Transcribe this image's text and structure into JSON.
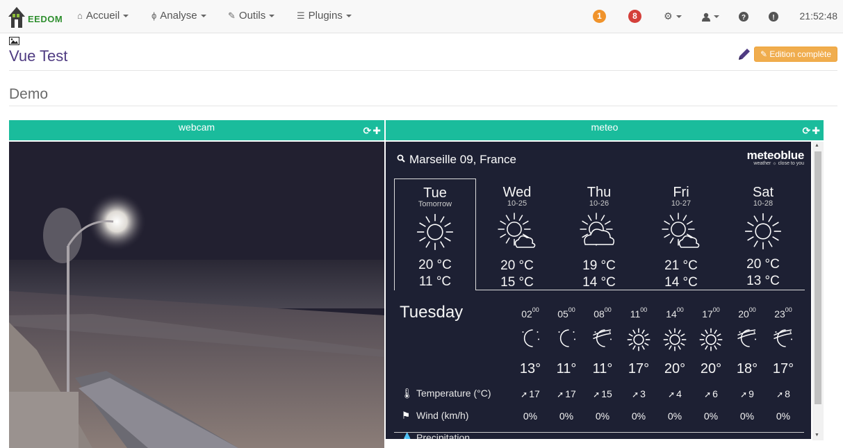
{
  "navbar": {
    "logo_text": "EEDOM",
    "menu": [
      {
        "label": "Accueil",
        "icon": "home-icon"
      },
      {
        "label": "Analyse",
        "icon": "stethoscope-icon"
      },
      {
        "label": "Outils",
        "icon": "wrench-icon"
      },
      {
        "label": "Plugins",
        "icon": "list-icon"
      }
    ],
    "badges": [
      {
        "value": "1",
        "color": "#f0932b"
      },
      {
        "value": "8",
        "color": "#d43f3a"
      }
    ],
    "clock": "21:52:48"
  },
  "view": {
    "title": "Vue Test",
    "edit_button": "Edition complète",
    "section_title": "Demo"
  },
  "widgets": {
    "webcam": {
      "title": "webcam"
    },
    "meteo": {
      "title": "meteo"
    }
  },
  "weather": {
    "location": "Marseille 09, France",
    "brand": "meteoblue",
    "brand_tag": "weather ☼ close to you",
    "days": [
      {
        "name": "Tue",
        "date": "Tomorrow",
        "icon": "sun",
        "max": "20 °C",
        "min": "11 °C"
      },
      {
        "name": "Wed",
        "date": "10-25",
        "icon": "sun-cloud",
        "max": "20 °C",
        "min": "15 °C"
      },
      {
        "name": "Thu",
        "date": "10-26",
        "icon": "cloud-sun",
        "max": "19 °C",
        "min": "14 °C"
      },
      {
        "name": "Fri",
        "date": "10-27",
        "icon": "sun-cloud",
        "max": "21 °C",
        "min": "14 °C"
      },
      {
        "name": "Sat",
        "date": "10-28",
        "icon": "sun",
        "max": "20 °C",
        "min": "13 °C"
      }
    ],
    "detail_day": "Tuesday",
    "labels": {
      "temperature": "Temperature (°C)",
      "wind": "Wind (km/h)",
      "precipitation": "Precipitation"
    },
    "hours": [
      {
        "h": "02",
        "m": "00",
        "icon": "moon",
        "temp": "13°",
        "wind": "17",
        "prec": "0%"
      },
      {
        "h": "05",
        "m": "00",
        "icon": "moon",
        "temp": "11°",
        "wind": "17",
        "prec": "0%"
      },
      {
        "h": "08",
        "m": "00",
        "icon": "moon-haze",
        "temp": "11°",
        "wind": "15",
        "prec": "0%"
      },
      {
        "h": "11",
        "m": "00",
        "icon": "sun",
        "temp": "17°",
        "wind": "3",
        "prec": "0%"
      },
      {
        "h": "14",
        "m": "00",
        "icon": "sun",
        "temp": "20°",
        "wind": "4",
        "prec": "0%"
      },
      {
        "h": "17",
        "m": "00",
        "icon": "sun",
        "temp": "20°",
        "wind": "6",
        "prec": "0%"
      },
      {
        "h": "20",
        "m": "00",
        "icon": "moon-haze",
        "temp": "18°",
        "wind": "9",
        "prec": "0%"
      },
      {
        "h": "23",
        "m": "00",
        "icon": "moon-haze",
        "temp": "17°",
        "wind": "8",
        "prec": "0%"
      }
    ]
  }
}
